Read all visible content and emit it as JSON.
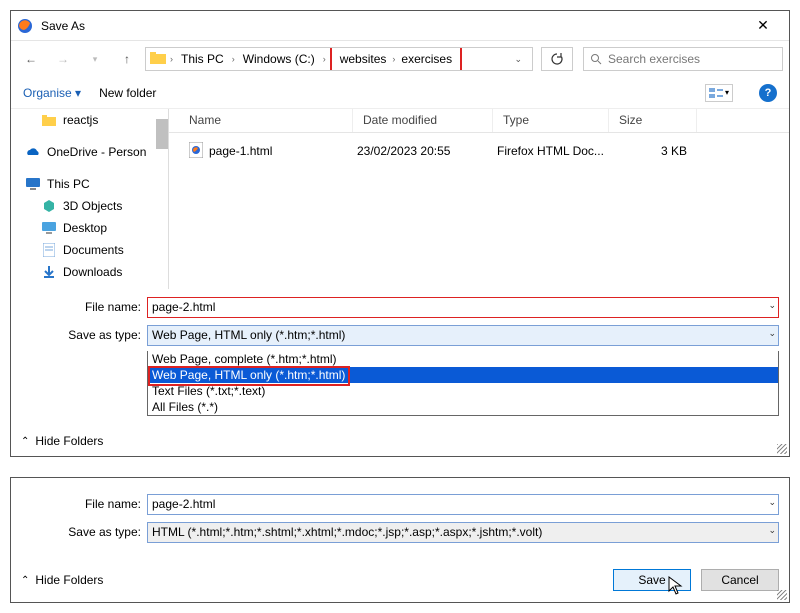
{
  "dialog1": {
    "title": "Save As",
    "nav": {
      "back": "←",
      "fwd": "→",
      "up": "↑"
    },
    "path": {
      "root": "This PC",
      "drive": "Windows (C:)",
      "folder1": "websites",
      "folder2": "exercises"
    },
    "search_placeholder": "Search exercises",
    "toolbar": {
      "organise": "Organise ▾",
      "newfolder": "New folder"
    },
    "tree": {
      "reactjs": "reactjs",
      "onedrive": "OneDrive - Person",
      "thispc": "This PC",
      "obj3d": "3D Objects",
      "desktop": "Desktop",
      "documents": "Documents",
      "downloads": "Downloads"
    },
    "list": {
      "col_name": "Name",
      "col_mod": "Date modified",
      "col_type": "Type",
      "col_size": "Size",
      "row1_name": "page-1.html",
      "row1_mod": "23/02/2023 20:55",
      "row1_type": "Firefox HTML Doc...",
      "row1_size": "3 KB"
    },
    "form": {
      "filename_label": "File name:",
      "filename_value": "page-2.html",
      "saveas_label": "Save as type:",
      "saveas_value": "Web Page, HTML only (*.htm;*.html)",
      "opt1": "Web Page, complete (*.htm;*.html)",
      "opt2": "Web Page, HTML only (*.htm;*.html)",
      "opt3": "Text Files (*.txt;*.text)",
      "opt4": "All Files (*.*)"
    },
    "hide_folders": "Hide Folders"
  },
  "dialog2": {
    "filename_label": "File name:",
    "filename_value": "page-2.html",
    "saveas_label": "Save as type:",
    "saveas_value": "HTML (*.html;*.htm;*.shtml;*.xhtml;*.mdoc;*.jsp;*.asp;*.aspx;*.jshtm;*.volt)",
    "hide_folders": "Hide Folders",
    "save": "Save",
    "cancel": "Cancel"
  }
}
